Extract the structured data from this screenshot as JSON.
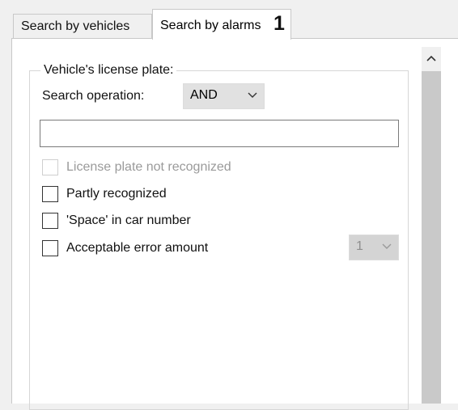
{
  "tabs": [
    {
      "label": "Search by vehicles",
      "active": false
    },
    {
      "label": "Search by alarms",
      "active": true
    }
  ],
  "callout_number": "1",
  "group": {
    "title": "Vehicle's license plate:",
    "search_operation": {
      "label": "Search operation:",
      "value": "AND"
    },
    "plate_input": {
      "value": "",
      "placeholder": ""
    },
    "checkboxes": [
      {
        "label": "License plate not recognized",
        "checked": false,
        "enabled": false
      },
      {
        "label": "Partly recognized",
        "checked": false,
        "enabled": true
      },
      {
        "label": "'Space' in car number",
        "checked": false,
        "enabled": true
      },
      {
        "label": "Acceptable error amount",
        "checked": false,
        "enabled": true
      }
    ],
    "error_amount": {
      "value": "1",
      "enabled": false
    }
  },
  "colors": {
    "window_bg": "#f0f0f0",
    "panel_bg": "#ffffff",
    "scroll_thumb": "#c9c9c9",
    "disabled_text": "#9a9a9a"
  },
  "icons": {
    "scroll_up": "chevron-up-icon",
    "dropdown": "chevron-down-icon"
  }
}
